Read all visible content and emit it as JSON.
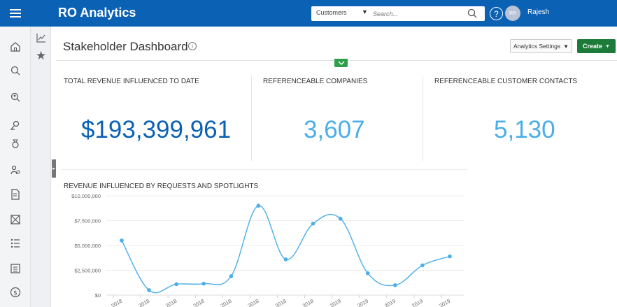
{
  "topbar": {
    "app_title": "RO Analytics",
    "search_type": "Customers",
    "search_placeholder": "Search...",
    "user_initials": "RR",
    "user_name": "Rajesh",
    "brand_color": "#0b61b4"
  },
  "leftnav": {
    "icons": [
      "home-icon",
      "search-icon",
      "customer-search-icon",
      "reference-search-icon",
      "award-icon",
      "users-icon",
      "content-icon",
      "spotlight-icon",
      "list-icon",
      "calendar-icon",
      "dollar-icon"
    ]
  },
  "subnav": {
    "icons": [
      "analytics-icon",
      "favorites-star-icon"
    ]
  },
  "header": {
    "title": "Stakeholder Dashboard",
    "settings_label": "Analytics Settings",
    "create_label": "Create",
    "create_color": "#1d7b3a"
  },
  "kpis": [
    {
      "label": "TOTAL REVENUE INFLUENCED TO DATE",
      "value": "$193,399,961",
      "color": "#0b61b4"
    },
    {
      "label": "REFERENCEABLE COMPANIES",
      "value": "3,607",
      "color": "#4aaee8"
    },
    {
      "label": "REFERENCEABLE CUSTOMER CONTACTS",
      "value": "5,130",
      "color": "#4aaee8"
    }
  ],
  "chart_data": {
    "type": "line",
    "title": "REVENUE INFLUENCED BY REQUESTS AND SPOTLIGHTS",
    "xlabel": "",
    "ylabel": "",
    "ylim": [
      0,
      10000000
    ],
    "y_ticks": [
      "$0",
      "$2,500,000",
      "$5,000,000",
      "$7,500,000",
      "$10,000,000"
    ],
    "y_tick_values": [
      0,
      2500000,
      5000000,
      7500000,
      10000000
    ],
    "categories": [
      "2018",
      "2018",
      "2018",
      "2018",
      "2018",
      "2018",
      "2018",
      "2018",
      "2019",
      "2019",
      "2019",
      "2019",
      "2019"
    ],
    "series": [
      {
        "values": [
          5500000,
          500000,
          1100000,
          1150000,
          1900000,
          9000000,
          3600000,
          7200000,
          7700000,
          2200000,
          1000000,
          3000000,
          3900000
        ],
        "color": "#4aaee8"
      }
    ],
    "grid": true,
    "legend": "none"
  }
}
